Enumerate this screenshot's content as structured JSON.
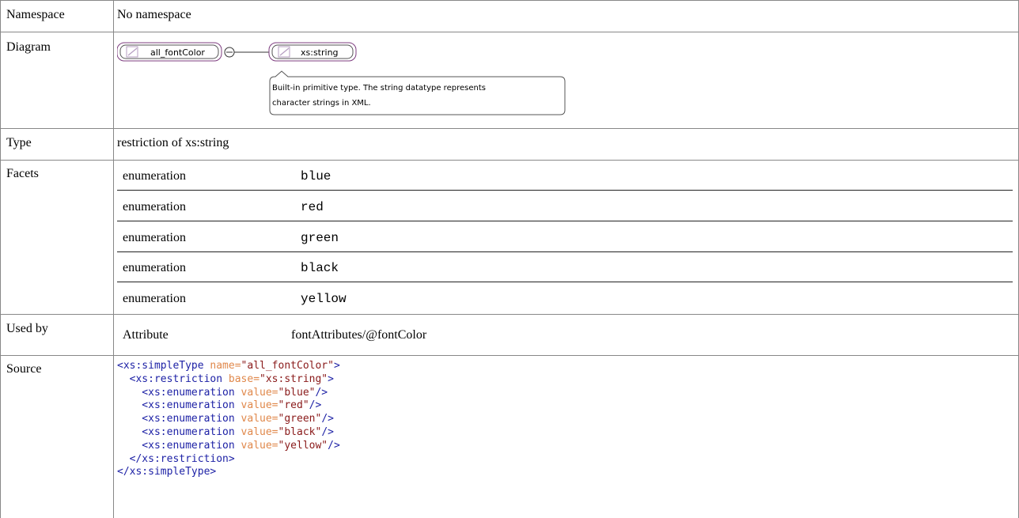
{
  "rows": {
    "namespace": {
      "label": "Namespace",
      "value": "No namespace"
    },
    "diagram": {
      "label": "Diagram",
      "element_name": "all_fontColor",
      "base_type": "xs:string",
      "doc_line1": "Built-in primitive type. The string datatype represents",
      "doc_line2": "character strings in XML."
    },
    "type": {
      "label": "Type",
      "value": "restriction of xs:string"
    },
    "facets": {
      "label": "Facets",
      "items": [
        {
          "kind": "enumeration",
          "value": "blue"
        },
        {
          "kind": "enumeration",
          "value": "red"
        },
        {
          "kind": "enumeration",
          "value": "green"
        },
        {
          "kind": "enumeration",
          "value": "black"
        },
        {
          "kind": "enumeration",
          "value": "yellow"
        }
      ]
    },
    "used_by": {
      "label": "Used by",
      "kind": "Attribute",
      "value": "fontAttributes/@fontColor"
    },
    "source": {
      "label": "Source",
      "lines": [
        [
          [
            "tag",
            "<xs:simpleType "
          ],
          [
            "attr",
            "name="
          ],
          [
            "str",
            "\"all_fontColor\""
          ],
          [
            "tag",
            ">"
          ]
        ],
        [
          [
            "tag",
            "  <xs:restriction "
          ],
          [
            "attr",
            "base="
          ],
          [
            "str",
            "\"xs:string\""
          ],
          [
            "tag",
            ">"
          ]
        ],
        [
          [
            "tag",
            "    <xs:enumeration "
          ],
          [
            "attr",
            "value="
          ],
          [
            "str",
            "\"blue\""
          ],
          [
            "tag",
            "/>"
          ]
        ],
        [
          [
            "tag",
            "    <xs:enumeration "
          ],
          [
            "attr",
            "value="
          ],
          [
            "str",
            "\"red\""
          ],
          [
            "tag",
            "/>"
          ]
        ],
        [
          [
            "tag",
            "    <xs:enumeration "
          ],
          [
            "attr",
            "value="
          ],
          [
            "str",
            "\"green\""
          ],
          [
            "tag",
            "/>"
          ]
        ],
        [
          [
            "tag",
            "    <xs:enumeration "
          ],
          [
            "attr",
            "value="
          ],
          [
            "str",
            "\"black\""
          ],
          [
            "tag",
            "/>"
          ]
        ],
        [
          [
            "tag",
            "    <xs:enumeration "
          ],
          [
            "attr",
            "value="
          ],
          [
            "str",
            "\"yellow\""
          ],
          [
            "tag",
            "/>"
          ]
        ],
        [
          [
            "tag",
            "  </xs:restriction>"
          ]
        ],
        [
          [
            "tag",
            "</xs:simpleType>"
          ]
        ]
      ]
    }
  },
  "colors": {
    "tag": "#1e22a6",
    "attr": "#e0884b",
    "str": "#8a1a1a",
    "diagram_border": "#7d3c7f",
    "grid": "#888888"
  }
}
